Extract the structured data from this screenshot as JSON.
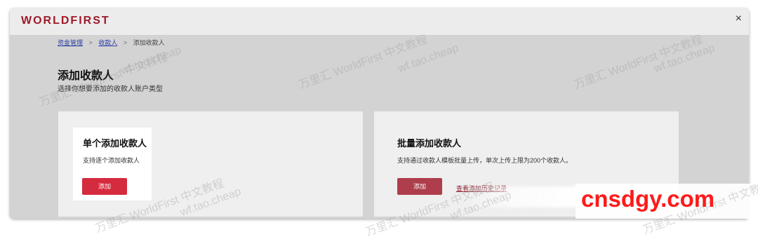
{
  "app": {
    "brand": "WORLDFIRST"
  },
  "breadcrumb": {
    "item1": "资金管理",
    "item2": "收款人",
    "item3": "添加收款人",
    "sep": ">"
  },
  "page": {
    "title": "添加收款人",
    "subtitle": "选择你想要添加的收款人账户类型"
  },
  "cards": {
    "single": {
      "title": "单个添加收款人",
      "desc": "支持逐个添加收款人",
      "button": "添加"
    },
    "batch": {
      "title": "批量添加收款人",
      "desc": "支持通过收款人模板批量上传，单次上传上限为200个收款人。",
      "button": "添加",
      "link": "查看添加历史记录"
    }
  },
  "window": {
    "close": "×"
  },
  "watermarks": [
    "万里汇 WorldFirst 中文教程",
    "wf.tao.cheap"
  ],
  "overlay_text": "cnsdgy.com",
  "colors": {
    "brand": "#9e1a2b",
    "button": "#d52b3f",
    "overlay_text": "#ff1a1a"
  }
}
